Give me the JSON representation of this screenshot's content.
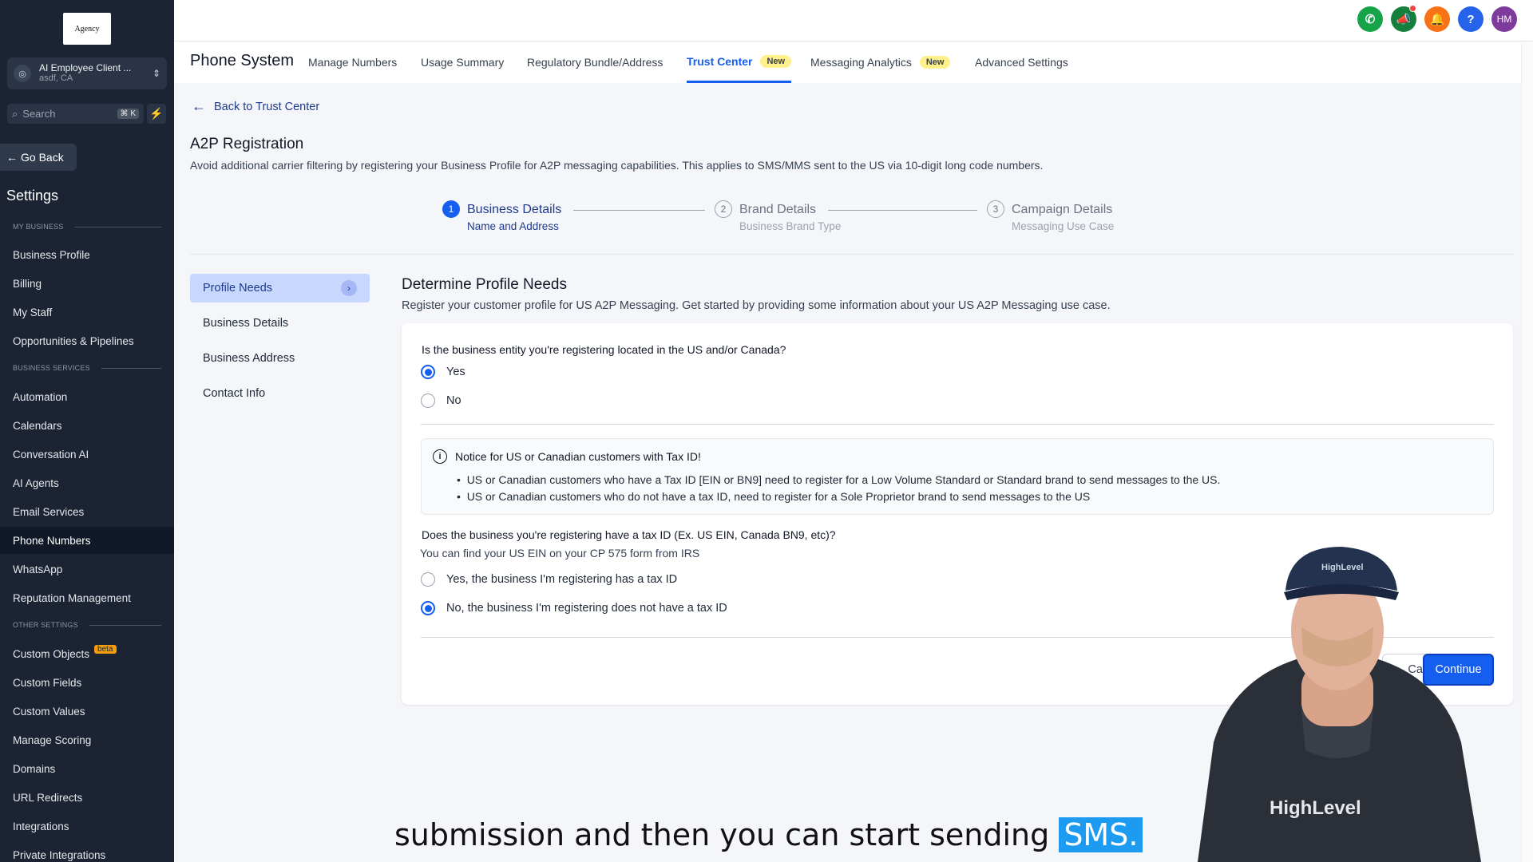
{
  "sidebar": {
    "logo_text": "Agency",
    "account": {
      "name": "AI Employee Client ...",
      "location": "asdf, CA"
    },
    "search": {
      "placeholder": "Search",
      "shortcut": "⌘ K"
    },
    "go_back": "Go Back",
    "settings_title": "Settings",
    "sections": {
      "my_business": "MY BUSINESS",
      "business_services": "BUSINESS SERVICES",
      "other_settings": "OTHER SETTINGS"
    },
    "my_business_items": [
      "Business Profile",
      "Billing",
      "My Staff",
      "Opportunities & Pipelines"
    ],
    "business_services_items": [
      "Automation",
      "Calendars",
      "Conversation AI",
      "AI Agents",
      "Email Services",
      "Phone Numbers",
      "WhatsApp",
      "Reputation Management"
    ],
    "other_settings_items": [
      "Custom Objects",
      "Custom Fields",
      "Custom Values",
      "Manage Scoring",
      "Domains",
      "URL Redirects",
      "Integrations",
      "Private Integrations"
    ],
    "beta_label": "beta",
    "active_item": "Phone Numbers"
  },
  "topbar": {
    "icons": [
      "phone-icon",
      "megaphone-icon",
      "bell-icon",
      "help-icon"
    ],
    "avatar_initials": "HM",
    "colors": {
      "phone": "#16a34a",
      "megaphone": "#15803d",
      "bell": "#f97316",
      "help": "#2563eb",
      "avatar": "#7e3a9c"
    }
  },
  "subnav": {
    "title": "Phone System",
    "tabs": [
      {
        "label": "Manage Numbers"
      },
      {
        "label": "Usage Summary"
      },
      {
        "label": "Regulatory Bundle/Address"
      },
      {
        "label": "Trust Center",
        "badge": "New",
        "active": true
      },
      {
        "label": "Messaging Analytics",
        "badge": "New"
      },
      {
        "label": "Advanced Settings"
      }
    ]
  },
  "main": {
    "back_link": "Back to Trust Center",
    "heading": "A2P Registration",
    "subheading": "Avoid additional carrier filtering by registering your Business Profile for A2P messaging capabilities. This applies to SMS/MMS sent to the US via 10-digit long code numbers.",
    "steps": [
      {
        "num": "1",
        "title": "Business Details",
        "sub": "Name and Address",
        "state": "active"
      },
      {
        "num": "2",
        "title": "Brand Details",
        "sub": "Business Brand Type",
        "state": "pending"
      },
      {
        "num": "3",
        "title": "Campaign Details",
        "sub": "Messaging Use Case",
        "state": "pending"
      }
    ],
    "side_steps": [
      "Profile Needs",
      "Business Details",
      "Business Address",
      "Contact Info"
    ],
    "section_title": "Determine Profile Needs",
    "section_sub": "Register your customer profile for US A2P Messaging. Get started by providing some information about your US A2P Messaging use case.",
    "q1": "Is the business entity you're registering located in the US and/or Canada?",
    "q1_options": [
      "Yes",
      "No"
    ],
    "q1_selected": "Yes",
    "notice_title": "Notice for US or Canadian customers with Tax ID!",
    "notice_bullets": [
      "US or Canadian customers who have a Tax ID [EIN or BN9] need to register for a Low Volume Standard or Standard brand to send messages to the US.",
      "US or Canadian customers who do not have a tax ID, need to register for a Sole Proprietor brand to send messages to the US"
    ],
    "q2": "Does the business you're registering have a tax ID (Ex. US EIN, Canada BN9, etc)?",
    "q2_help": "You can find your US EIN on your CP 575 form from IRS",
    "q2_options": [
      "Yes, the business I'm registering has a tax ID",
      "No, the business I'm registering does not have a tax ID"
    ],
    "q2_selected": "No, the business I'm registering does not have a tax ID",
    "cancel_label": "Cancel",
    "continue_label": "Continue"
  },
  "overlay": {
    "cap_logo": "HighLevel",
    "shirt_logo": "HighLevel",
    "caption": "submission and then you can start sending",
    "caption_highlight": "SMS."
  }
}
